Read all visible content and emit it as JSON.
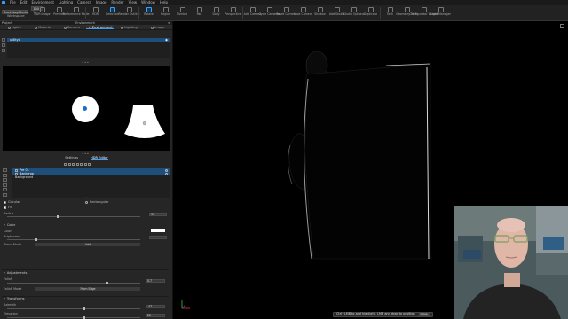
{
  "menubar": {
    "items": [
      "File",
      "Edit",
      "Environment",
      "Lighting",
      "Camera",
      "Image",
      "Render",
      "View",
      "Window",
      "Help"
    ]
  },
  "toolbar": {
    "workspace_value": "BackstagStudio",
    "zoom_value": "100 %",
    "workspace_label": "Workspace",
    "items": [
      {
        "label": "HDR Image",
        "icon": "image-icon"
      },
      {
        "label": "Preview",
        "icon": "preview-icon"
      },
      {
        "label": "Performance Mode",
        "icon": "performance-icon"
      },
      {
        "label": "HDR",
        "icon": "hdr-icon"
      },
      {
        "label": "Selection",
        "icon": "selection-icon"
      },
      {
        "label": "Render Outline",
        "icon": "outline-icon"
      },
      {
        "label": "Rotate",
        "icon": "rotate-icon"
      },
      {
        "label": "Region",
        "icon": "region-icon"
      },
      {
        "label": "Tumble",
        "icon": "tumble-icon"
      },
      {
        "label": "Pan",
        "icon": "pan-icon"
      },
      {
        "label": "Dolly",
        "icon": "dolly-icon"
      },
      {
        "label": "Perspective",
        "icon": "perspective-icon"
      },
      {
        "label": "Add Camera",
        "icon": "add-camera-icon"
      },
      {
        "label": "Cycle Cameras",
        "icon": "cycle-cameras-icon"
      },
      {
        "label": "Reset Camera",
        "icon": "reset-camera-icon"
      },
      {
        "label": "Look Camera",
        "icon": "look-camera-icon"
      },
      {
        "label": "Shadow",
        "icon": "shadow-icon"
      },
      {
        "label": "Add Studio",
        "icon": "add-studio-icon"
      },
      {
        "label": "Studio Options",
        "icon": "studio-options-icon"
      },
      {
        "label": "Duplicate",
        "icon": "duplicate-icon"
      },
      {
        "label": "Tech",
        "icon": "tech-icon"
      },
      {
        "label": "Geometry Filter",
        "icon": "geometry-filter-icon"
      },
      {
        "label": "Configurator Wizard",
        "icon": "configurator-icon"
      },
      {
        "label": "Light Manager",
        "icon": "light-manager-icon"
      }
    ]
  },
  "panel": {
    "left_title": "Project",
    "center_title": "Environment",
    "tabs": [
      "Lights",
      "Material",
      "Camera",
      "Environment",
      "Lighting",
      "Image"
    ],
    "active_tab": "Environment",
    "env_item": "utilityL",
    "sub_tabs": [
      "Settings",
      "HDR Editor"
    ],
    "lights": [
      {
        "name": "Pre 01",
        "selected": true
      },
      {
        "name": "Backdrop",
        "selected": true
      },
      {
        "name": "Background",
        "selected": false
      }
    ],
    "shape": {
      "circular": "Circular",
      "rectangular": "Rectangular"
    },
    "fill_label": "Fill",
    "radius_label": "Radius",
    "radius_value": "36",
    "color_section": "Color",
    "color_label": "Color",
    "brightness_label": "Brightness",
    "blend_mode_label": "Blend Mode",
    "blend_mode_value": "Add",
    "adjustments_section": "Adjustments",
    "falloff_label": "Falloff",
    "falloff_value": "0.7",
    "falloff_mode_label": "Falloff Mode",
    "falloff_mode_value": "From Edge",
    "transforms_section": "Transforms",
    "azimuth_label": "Azimuth",
    "azimuth_value": "-47",
    "elevation_label": "Elevation",
    "elevation_value": "22"
  },
  "viewport": {
    "status_message": "Ctrl+LMB to add highlight, LMB and drag to position",
    "close_label": "Close"
  },
  "colors": {
    "accent": "#3aa0ff",
    "selection": "#1e4f7a",
    "panel_bg": "#262626",
    "viewport_bg": "#000000"
  }
}
